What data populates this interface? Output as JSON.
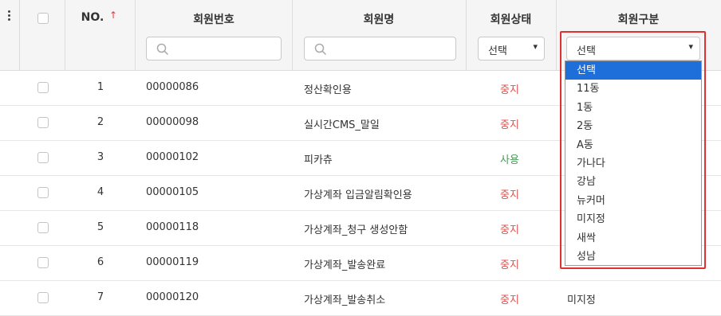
{
  "columns": {
    "no": "NO.",
    "member_number": "회원번호",
    "member_name": "회원명",
    "member_status": "회원상태",
    "member_type": "회원구분"
  },
  "filters": {
    "status_selected": "선택",
    "type_selected": "선택"
  },
  "type_options": [
    "선택",
    "11동",
    "1동",
    "2동",
    "A동",
    "가나다",
    "강남",
    "뉴커머",
    "미지정",
    "새싹",
    "성남"
  ],
  "rows": [
    {
      "no": "1",
      "number": "00000086",
      "name": "정산확인용",
      "status": "중지",
      "type": ""
    },
    {
      "no": "2",
      "number": "00000098",
      "name": "실시간CMS_말일",
      "status": "중지",
      "type": ""
    },
    {
      "no": "3",
      "number": "00000102",
      "name": "피카츄",
      "status": "사용",
      "type": ""
    },
    {
      "no": "4",
      "number": "00000105",
      "name": "가상계좌 입금알림확인용",
      "status": "중지",
      "type": ""
    },
    {
      "no": "5",
      "number": "00000118",
      "name": "가상계좌_청구 생성안함",
      "status": "중지",
      "type": ""
    },
    {
      "no": "6",
      "number": "00000119",
      "name": "가상계좌_발송완료",
      "status": "중지",
      "type": ""
    },
    {
      "no": "7",
      "number": "00000120",
      "name": "가상계좌_발송취소",
      "status": "중지",
      "type": "미지정"
    }
  ],
  "colors": {
    "status_stopped": "#d9534f",
    "status_active": "#4a9b5a",
    "highlight": "#e03030",
    "option_active": "#1e6fd9"
  }
}
